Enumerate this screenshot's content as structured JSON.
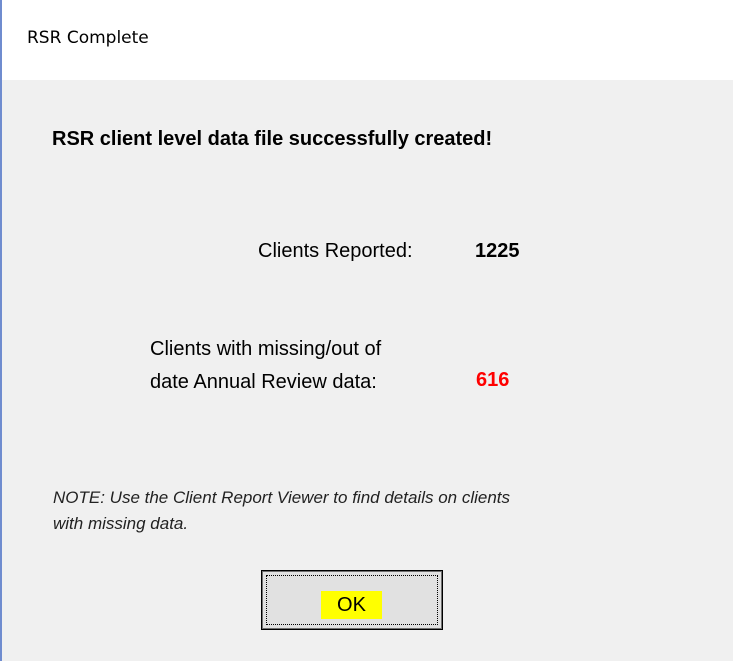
{
  "window": {
    "title": "RSR Complete"
  },
  "dialog": {
    "heading": "RSR client level data file successfully created!",
    "clients_reported_label": "Clients Reported:",
    "clients_reported_value": "1225",
    "missing_label_line1": "Clients with missing/out of",
    "missing_label_line2": "date Annual Review data:",
    "missing_value": "616",
    "note_line1": "NOTE: Use the Client Report Viewer to find details on clients",
    "note_line2": "with missing data.",
    "ok_label": "OK"
  },
  "colors": {
    "missing_value": "#ff0000",
    "ok_highlight": "#ffff00",
    "window_border": "#6f8ccf",
    "dialog_background": "#f0f0f0"
  }
}
